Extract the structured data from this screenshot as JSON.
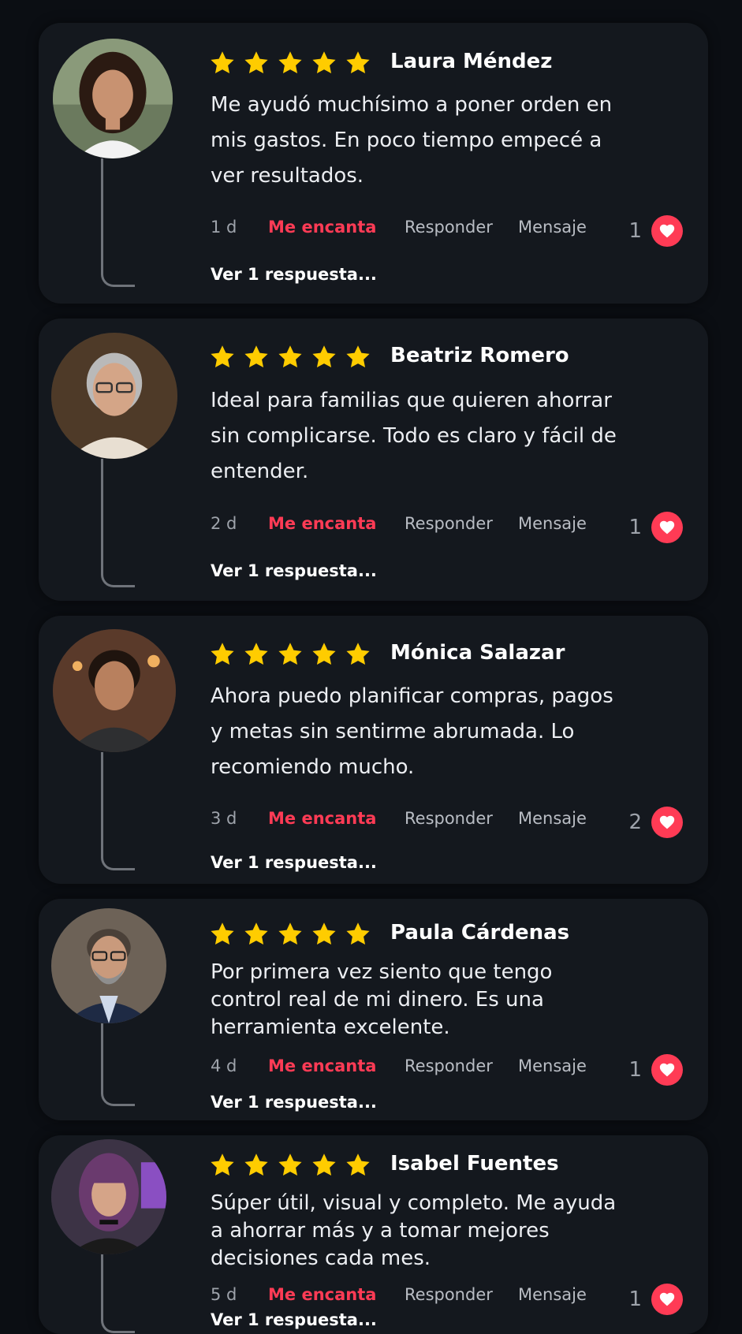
{
  "reviews": [
    {
      "name": "Laura Méndez",
      "rating": 5,
      "text": "Me ayudó muchísimo a poner orden en mis gastos. En poco tiempo empecé a ver resultados.",
      "time": "1 d",
      "like_action": "Me encanta",
      "reply_action": "Responder",
      "message_action": "Mensaje",
      "like_count": "1",
      "view_replies": "Ver 1 respuesta..."
    },
    {
      "name": "Beatriz Romero",
      "rating": 5,
      "text": "Ideal para familias que quieren ahorrar sin complicarse. Todo es claro y fácil de entender.",
      "time": "2 d",
      "like_action": "Me encanta",
      "reply_action": "Responder",
      "message_action": "Mensaje",
      "like_count": "1",
      "view_replies": "Ver 1 respuesta..."
    },
    {
      "name": "Mónica Salazar",
      "rating": 5,
      "text": "Ahora puedo planificar compras, pagos y metas sin sentirme abrumada. Lo recomiendo mucho.",
      "time": "3 d",
      "like_action": "Me encanta",
      "reply_action": "Responder",
      "message_action": "Mensaje",
      "like_count": "2",
      "view_replies": "Ver 1 respuesta..."
    },
    {
      "name": "Paula Cárdenas",
      "rating": 5,
      "text": "Por primera vez siento que tengo control real de mi dinero. Es una herramienta excelente.",
      "time": "4 d",
      "like_action": "Me encanta",
      "reply_action": "Responder",
      "message_action": "Mensaje",
      "like_count": "1",
      "view_replies": "Ver 1 respuesta..."
    },
    {
      "name": "Isabel Fuentes",
      "rating": 5,
      "text": "Súper útil, visual y completo. Me ayuda a ahorrar más y a tomar mejores decisiones cada mes.",
      "time": "5 d",
      "like_action": "Me encanta",
      "reply_action": "Responder",
      "message_action": "Mensaje",
      "like_count": "1",
      "view_replies": "Ver 1 respuesta..."
    }
  ],
  "colors": {
    "background": "#0b0e13",
    "card": "#14181e",
    "star": "#ffcc00",
    "accent_red": "#ff3b55",
    "muted_text": "#9ea3ab"
  },
  "icons": {
    "rating": "star-icon",
    "like": "heart-icon",
    "avatar": "user-photo"
  }
}
